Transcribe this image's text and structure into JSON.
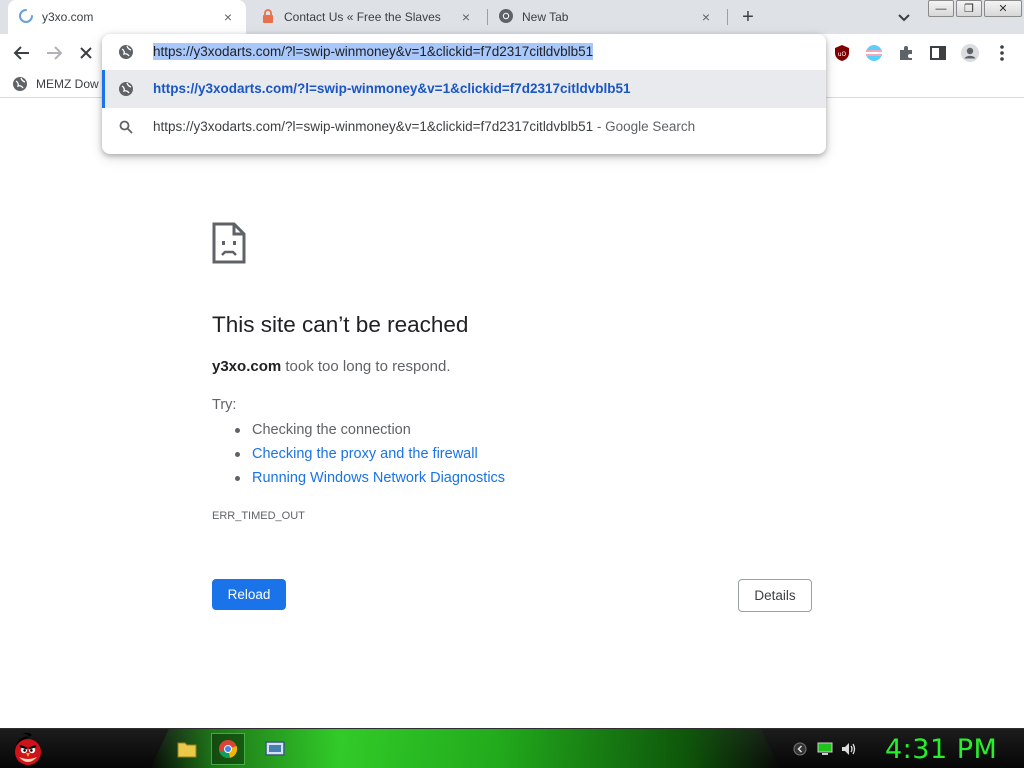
{
  "browser": {
    "tabs": [
      {
        "title": "y3xo.com",
        "active": true,
        "icon": "loading-spinner-icon"
      },
      {
        "title": "Contact Us « Free the Slaves",
        "active": false,
        "icon": "lock-favicon-icon"
      },
      {
        "title": "New Tab",
        "active": false,
        "icon": "chrome-favicon-icon"
      }
    ],
    "tab_close_glyph": "×",
    "new_tab_glyph": "+",
    "window_controls": {
      "minimize": "—",
      "restore": "❐",
      "close": "✕"
    }
  },
  "bookmarks": [
    {
      "label": "MEMZ Dow",
      "icon": "globe-icon"
    }
  ],
  "omnibox": {
    "input_value": "https://y3xodarts.com/?l=swip-winmoney&v=1&clickid=f7d2317citldvblb51",
    "suggestions": [
      {
        "text": "https://y3xodarts.com/?l=swip-winmoney&v=1&clickid=f7d2317citldvblb51",
        "suffix": "",
        "icon": "globe-icon",
        "selected": true
      },
      {
        "text": "https://y3xodarts.com/?l=swip-winmoney&v=1&clickid=f7d2317citldvblb51",
        "suffix": " - Google Search",
        "icon": "search-icon",
        "selected": false
      }
    ]
  },
  "error_page": {
    "title": "This site can’t be reached",
    "host": "y3xo.com",
    "desc_rest": " took too long to respond.",
    "try_label": "Try:",
    "suggestions": [
      {
        "text": "Checking the connection",
        "link": false
      },
      {
        "text": "Checking the proxy and the firewall",
        "link": true
      },
      {
        "text": "Running Windows Network Diagnostics",
        "link": true
      }
    ],
    "error_code": "ERR_TIMED_OUT",
    "reload_label": "Reload",
    "details_label": "Details"
  },
  "taskbar": {
    "clock": "4:31 PM",
    "accent_color": "#26f02b"
  },
  "colors": {
    "tabstrip_bg": "#dee1e6",
    "link_blue": "#1a73e8",
    "selection_blue": "#a8c7fa"
  }
}
